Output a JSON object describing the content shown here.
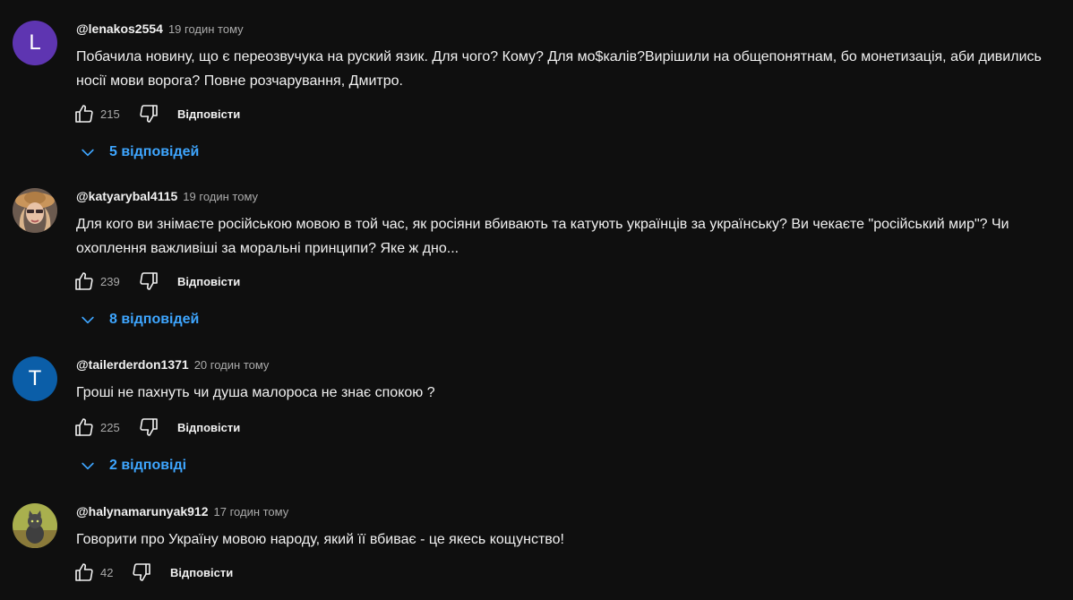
{
  "ui": {
    "reply_label": "Відповісти"
  },
  "comments": [
    {
      "author": "@lenakos2554",
      "time": "19 годин тому",
      "avatar_letter": "L",
      "avatar_color": "#5e35b1",
      "text": "Побачила новину, що є переозвучука на руский язик. Для чого? Кому? Для мо$калів?Вирішили на общепонятнам, бо монетизація, аби дивились носії мови ворога? Повне розчарування, Дмитро.",
      "likes": "215",
      "replies": "5 відповідей"
    },
    {
      "author": "@katyarybal4115",
      "time": "19 годин тому",
      "text": "Для кого ви знімаєте російською мовою в той час, як росіяни вбивають та катують українців за українську? Ви чекаєте \"російський мир\"? Чи охоплення важливіші за моральні принципи? Яке ж дно...",
      "likes": "239",
      "replies": "8 відповідей"
    },
    {
      "author": "@tailerderdon1371",
      "time": "20 годин тому",
      "avatar_letter": "T",
      "avatar_color": "#0b5ea8",
      "text": "Гроші не пахнуть чи душа малороса не знає спокою ?",
      "likes": "225",
      "replies": "2 відповіді"
    },
    {
      "author": "@halynamarunyak912",
      "time": "17 годин тому",
      "text": "Говорити про Україну мовою народу, який її вбиває - це якесь кощунство!",
      "likes": "42"
    }
  ],
  "colors": {
    "background": "#0f0f0f",
    "text_primary": "#f1f1f1",
    "text_secondary": "#aaaaaa",
    "link_blue": "#3ea6ff"
  },
  "icons": {
    "like": "thumbs-up-icon",
    "dislike": "thumbs-down-icon",
    "expand": "chevron-down-icon"
  }
}
